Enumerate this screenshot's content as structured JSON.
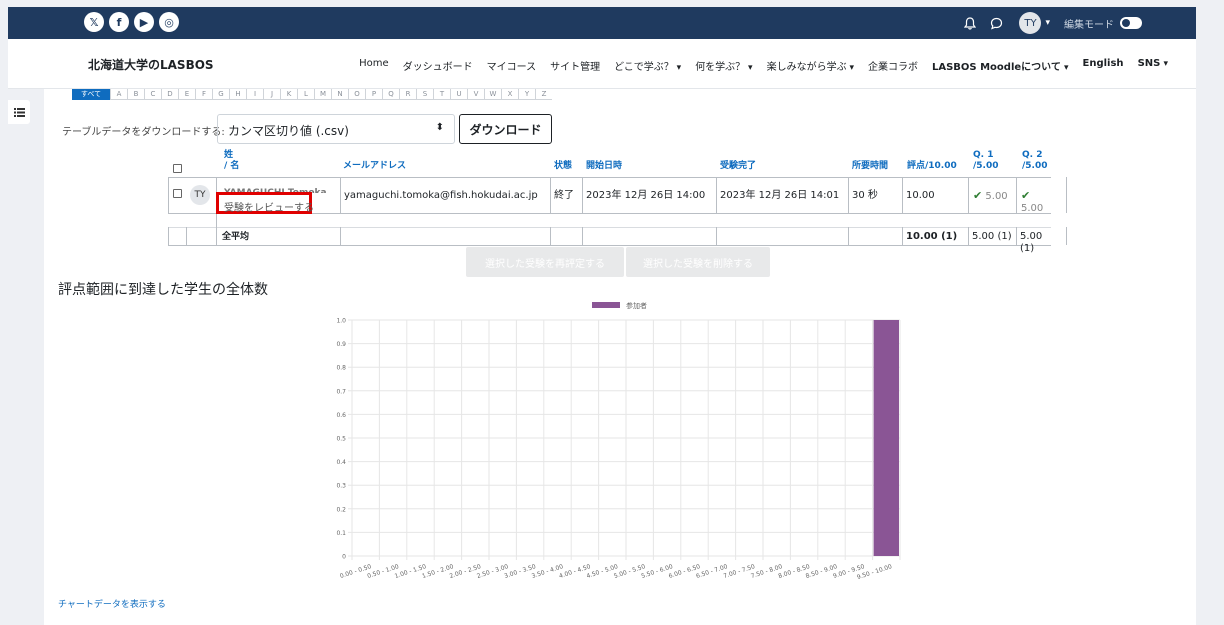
{
  "topbar": {
    "social": [
      "x",
      "f",
      "yt",
      "ig"
    ],
    "avatar_initials": "TY",
    "edit_mode_label": "編集モード"
  },
  "navbar": {
    "brand": "北海道大学のLASBOS",
    "items": [
      {
        "label": "Home",
        "dropdown": false
      },
      {
        "label": "ダッシュボード",
        "dropdown": false
      },
      {
        "label": "マイコース",
        "dropdown": false
      },
      {
        "label": "サイト管理",
        "dropdown": false
      },
      {
        "label": "どこで学ぶ？",
        "dropdown": true
      },
      {
        "label": "何を学ぶ？",
        "dropdown": true
      },
      {
        "label": "楽しみながら学ぶ",
        "dropdown": true
      },
      {
        "label": "企業コラボ",
        "dropdown": false
      },
      {
        "label": "LASBOS Moodleについて",
        "dropdown": true
      },
      {
        "label": "English",
        "dropdown": false
      },
      {
        "label": "SNS",
        "dropdown": true
      }
    ]
  },
  "letters": [
    "すべて",
    "A",
    "B",
    "C",
    "D",
    "E",
    "F",
    "G",
    "H",
    "I",
    "J",
    "K",
    "L",
    "M",
    "N",
    "O",
    "P",
    "Q",
    "R",
    "S",
    "T",
    "U",
    "V",
    "W",
    "X",
    "Y",
    "Z"
  ],
  "download": {
    "label": "テーブルデータをダウンロードする:",
    "format": "カンマ区切り値 (.csv)",
    "button": "ダウンロード"
  },
  "table": {
    "headers": {
      "name_last": "姓",
      "name_first": "/ 名",
      "email": "メールアドレス",
      "state": "状態",
      "started": "開始日時",
      "completed": "受験完了",
      "duration": "所要時間",
      "grade": "評点/10.00",
      "q1_a": "Q. 1",
      "q1_b": "/5.00",
      "q2_a": "Q. 2",
      "q2_b": "/5.00"
    },
    "row": {
      "initials": "TY",
      "name": "YAMAGUCHI Tomoka",
      "review_link": "受験をレビューする",
      "email": "yamaguchi.tomoka@fish.hokudai.ac.jp",
      "state": "終了",
      "started": "2023年 12月 26日 14:00",
      "completed": "2023年 12月 26日 14:01",
      "duration": "30 秒",
      "grade": "10.00",
      "q1": "5.00",
      "q2": "5.00"
    },
    "average": {
      "label": "全平均",
      "grade": "10.00 (1)",
      "q1": "5.00 (1)",
      "q2": "5.00 (1)"
    }
  },
  "buttons": {
    "regrade": "選択した受験を再評定する",
    "delete": "選択した受験を削除する"
  },
  "chart_title": "評点範囲に到達した学生の全体数",
  "show_chart_data": "チャートデータを表示する",
  "colors": {
    "bar": "#8a5595",
    "topbar": "#1f3a5f",
    "link": "#0f6cbf",
    "highlight": "#e00000"
  },
  "chart_data": {
    "type": "bar",
    "title": "",
    "legend": "top",
    "grid": true,
    "ylim": [
      0,
      1.0
    ],
    "yticks": [
      "1.0",
      "0.9",
      "0.8",
      "0.7",
      "0.6",
      "0.5",
      "0.4",
      "0.3",
      "0.2",
      "0.1",
      "0"
    ],
    "categories": [
      "0.00 - 0.50",
      "0.50 - 1.00",
      "1.00 - 1.50",
      "1.50 - 2.00",
      "2.00 - 2.50",
      "2.50 - 3.00",
      "3.00 - 3.50",
      "3.50 - 4.00",
      "4.00 - 4.50",
      "4.50 - 5.00",
      "5.00 - 5.50",
      "5.50 - 6.00",
      "6.00 - 6.50",
      "6.50 - 7.00",
      "7.00 - 7.50",
      "7.50 - 8.00",
      "8.00 - 8.50",
      "8.50 - 9.00",
      "9.00 - 9.50",
      "9.50 - 10.00"
    ],
    "series": [
      {
        "name": "参加者",
        "values": [
          0,
          0,
          0,
          0,
          0,
          0,
          0,
          0,
          0,
          0,
          0,
          0,
          0,
          0,
          0,
          0,
          0,
          0,
          0,
          1
        ]
      }
    ]
  }
}
